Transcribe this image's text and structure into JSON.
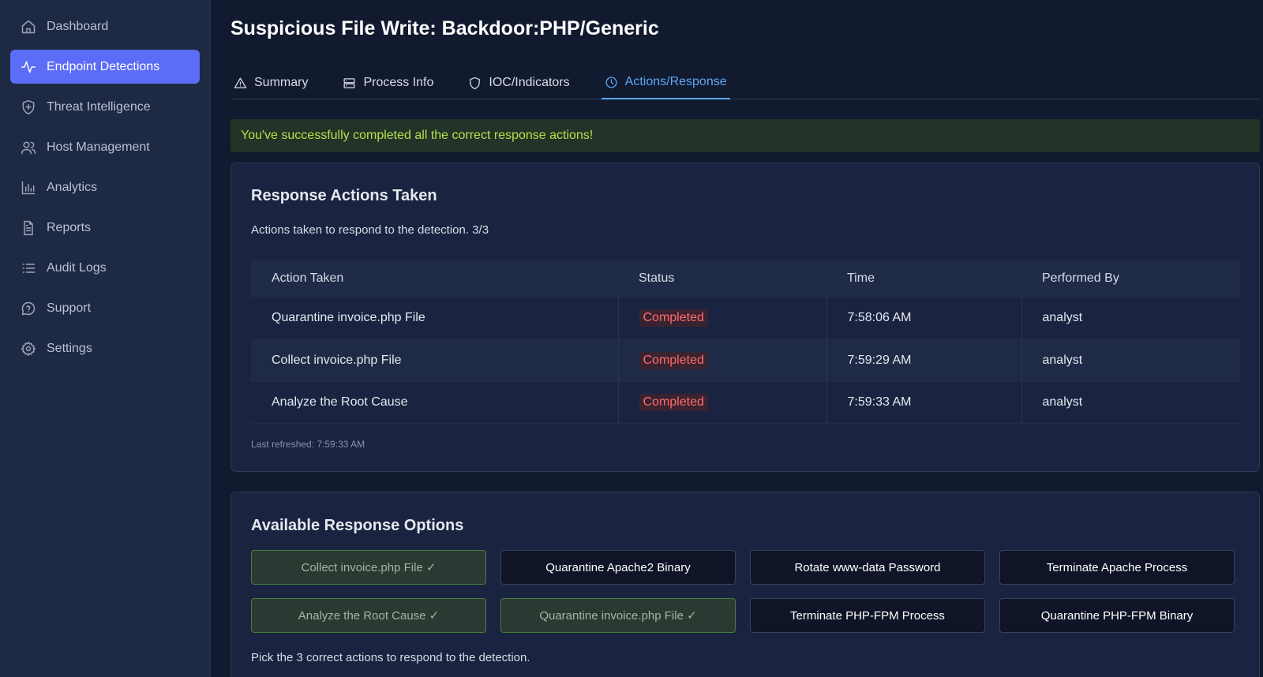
{
  "sidebar": {
    "items": [
      {
        "label": "Dashboard",
        "icon": "home-icon",
        "active": false
      },
      {
        "label": "Endpoint Detections",
        "icon": "activity-icon",
        "active": true
      },
      {
        "label": "Threat Intelligence",
        "icon": "shield-plus-icon",
        "active": false
      },
      {
        "label": "Host Management",
        "icon": "users-icon",
        "active": false
      },
      {
        "label": "Analytics",
        "icon": "bar-chart-icon",
        "active": false
      },
      {
        "label": "Reports",
        "icon": "file-text-icon",
        "active": false
      },
      {
        "label": "Audit Logs",
        "icon": "list-icon",
        "active": false
      },
      {
        "label": "Support",
        "icon": "help-chat-icon",
        "active": false
      },
      {
        "label": "Settings",
        "icon": "gear-icon",
        "active": false
      }
    ]
  },
  "header": {
    "title": "Suspicious File Write: Backdoor:PHP/Generic"
  },
  "tabs": [
    {
      "label": "Summary",
      "icon": "alert-triangle-icon",
      "active": false
    },
    {
      "label": "Process Info",
      "icon": "server-icon",
      "active": false
    },
    {
      "label": "IOC/Indicators",
      "icon": "shield-icon",
      "active": false
    },
    {
      "label": "Actions/Response",
      "icon": "clock-icon",
      "active": true
    }
  ],
  "banner": {
    "message": "You've successfully completed all the correct response actions!"
  },
  "actions_taken": {
    "title": "Response Actions Taken",
    "description": "Actions taken to respond to the detection. 3/3",
    "columns": [
      "Action Taken",
      "Status",
      "Time",
      "Performed By"
    ],
    "rows": [
      {
        "action": "Quarantine invoice.php File",
        "status": "Completed",
        "time": "7:58:06 AM",
        "by": "analyst"
      },
      {
        "action": "Collect invoice.php File",
        "status": "Completed",
        "time": "7:59:29 AM",
        "by": "analyst"
      },
      {
        "action": "Analyze the Root Cause",
        "status": "Completed",
        "time": "7:59:33 AM",
        "by": "analyst"
      }
    ],
    "last_refreshed": "Last refreshed: 7:59:33 AM"
  },
  "response_options": {
    "title": "Available Response Options",
    "options": [
      {
        "label": "Collect invoice.php File ✓",
        "done": true
      },
      {
        "label": "Quarantine Apache2 Binary",
        "done": false
      },
      {
        "label": "Rotate www-data Password",
        "done": false
      },
      {
        "label": "Terminate Apache Process",
        "done": false
      },
      {
        "label": "Analyze the Root Cause ✓",
        "done": true
      },
      {
        "label": "Quarantine invoice.php File ✓",
        "done": true
      },
      {
        "label": "Terminate PHP-FPM Process",
        "done": false
      },
      {
        "label": "Quarantine PHP-FPM Binary",
        "done": false
      }
    ],
    "hint": "Pick the 3 correct actions to respond to the detection."
  },
  "colors": {
    "accent": "#5b6cf6",
    "tab_active": "#5ea8f5",
    "success_text": "#b5e24e",
    "status_completed": "#ff6b6b"
  }
}
